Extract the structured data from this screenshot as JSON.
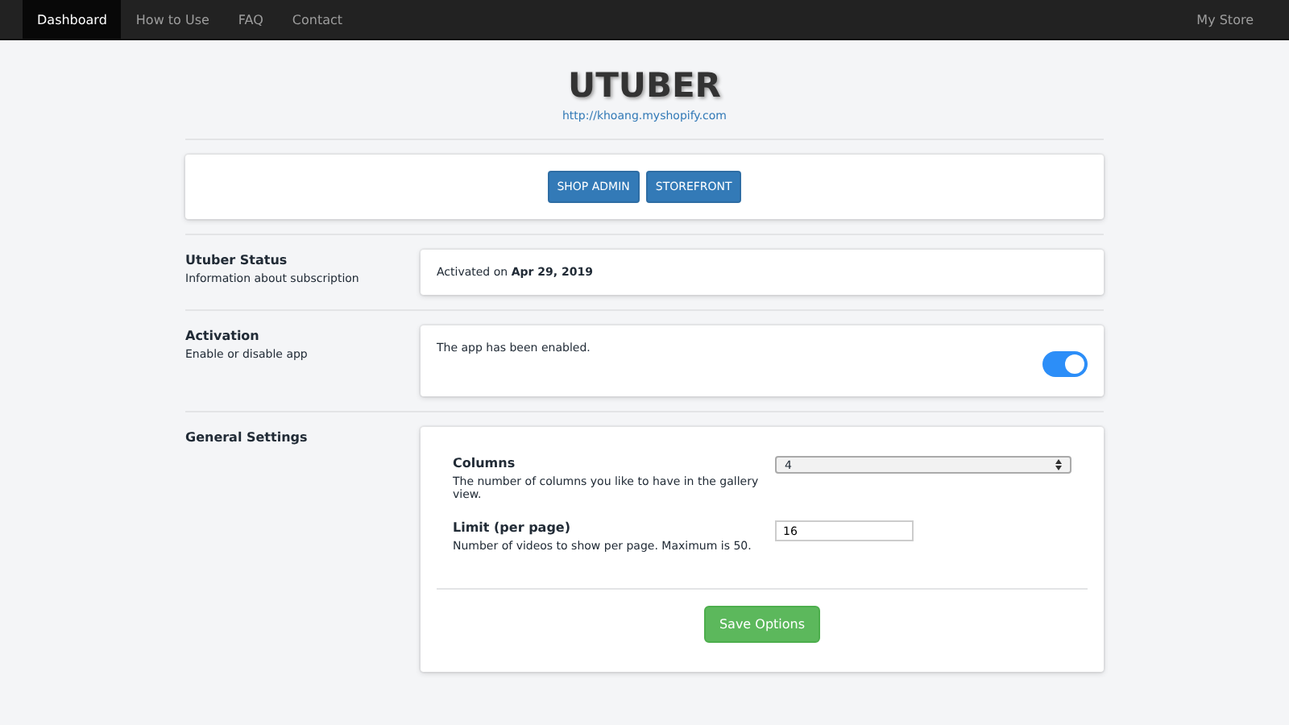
{
  "nav": {
    "items": [
      {
        "label": "Dashboard",
        "selected": true
      },
      {
        "label": "How to Use",
        "selected": false
      },
      {
        "label": "FAQ",
        "selected": false
      },
      {
        "label": "Contact",
        "selected": false
      }
    ],
    "right": "My Store"
  },
  "header": {
    "title": "UTUBER",
    "link": "http://khoang.myshopify.com"
  },
  "buttons": [
    "SHOP ADMIN",
    "STOREFRONT"
  ],
  "status": {
    "title": "Utuber Status",
    "description": "Information about subscription",
    "text": "Activated on **Apr 29, 2019**"
  },
  "activation": {
    "title": "Activation",
    "description": "Enable or disable app",
    "text": "The app has been enabled.",
    "on": true
  },
  "settings": {
    "title": "General Settings",
    "fields": [
      {
        "kind": "select",
        "label": "Columns",
        "help": "The number of columns you like to have in the gallery view.",
        "value": "4"
      },
      {
        "kind": "input",
        "label": "Limit (per page)",
        "help": "Number of videos to show per page. Maximum is 50.",
        "value": "16"
      }
    ],
    "save": "Save Options"
  }
}
